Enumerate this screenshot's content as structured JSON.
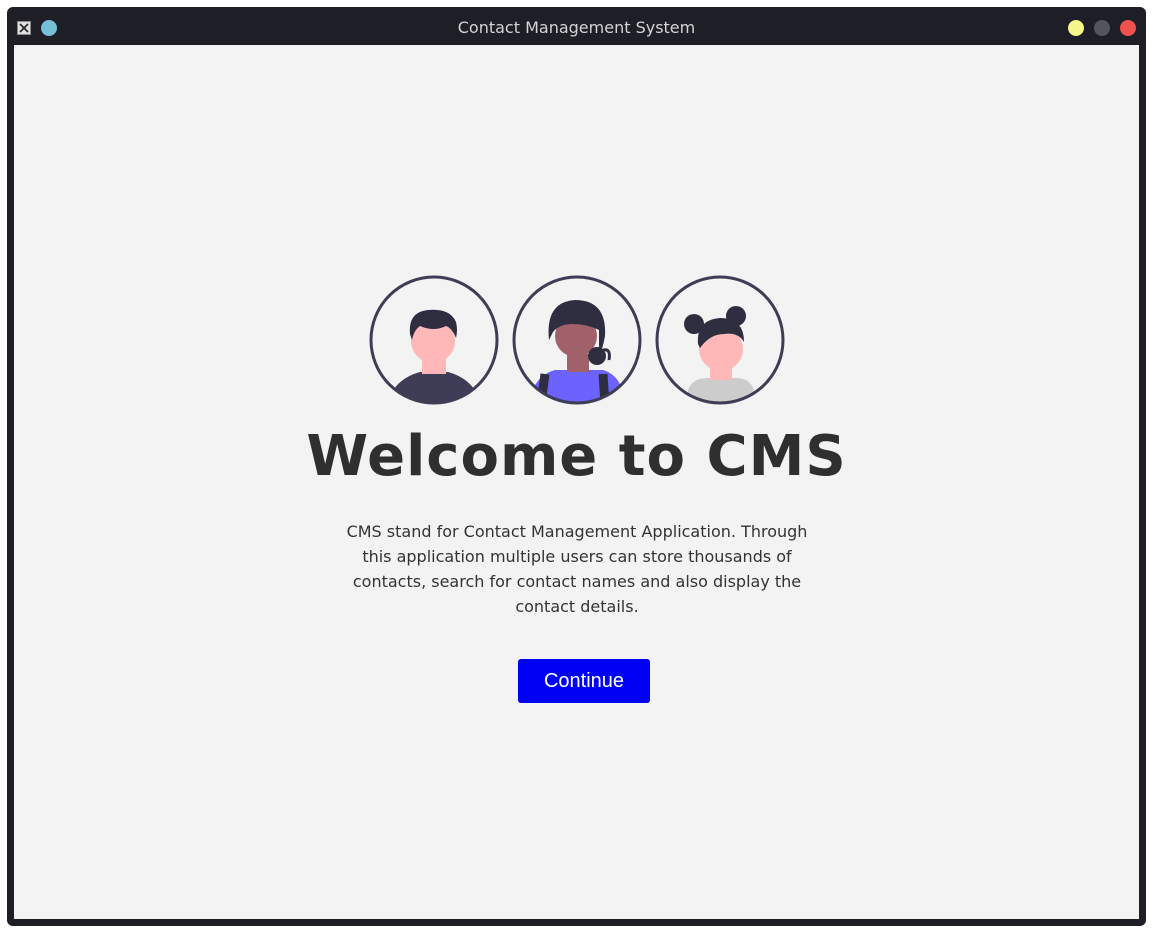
{
  "window": {
    "title": "Contact Management System",
    "app_icon": "x-app-icon",
    "controls": [
      "minimize-button",
      "maximize-button",
      "close-button"
    ]
  },
  "colors": {
    "window_frame": "#1e1f26",
    "background": "#f3f3f3",
    "pin_dot": "#74c0d7",
    "minimize": "#f5f58a",
    "maximize": "#54545e",
    "close": "#ef5350",
    "heading": "#2f2f2f",
    "button_bg": "#0000f5",
    "button_text": "#ffffff",
    "avatar_outline": "#3f3d56",
    "avatar_skin_light": "#ffb8b8",
    "avatar_skin_dark": "#a0616a",
    "avatar_hair": "#2f2e41",
    "avatar_shirt_purple": "#6c63ff",
    "avatar_shirt_gray": "#cccccc"
  },
  "welcome": {
    "heading": "Welcome to CMS",
    "description": "CMS stand for Contact Management Application. Through this application multiple users can store thousands of contacts, search for contact names and also display the contact details.",
    "continue_label": "Continue"
  },
  "avatars": [
    "man-avatar",
    "woman-avatar",
    "girl-avatar"
  ]
}
